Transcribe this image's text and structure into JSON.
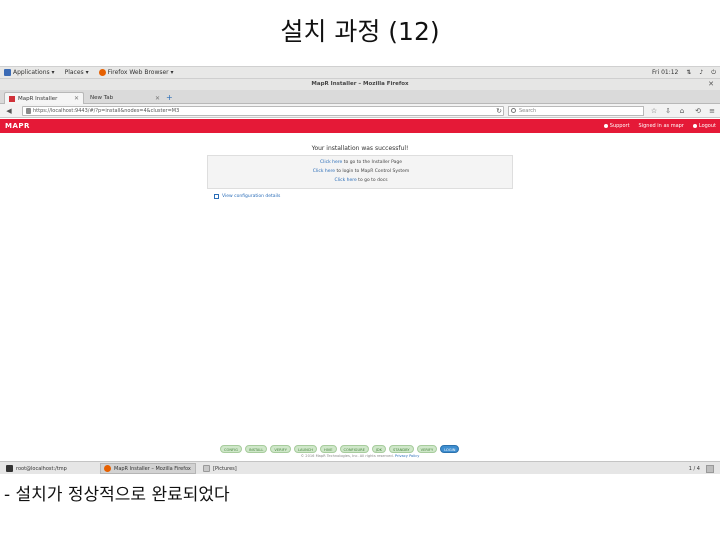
{
  "slide": {
    "title": "설치 과정 (12)",
    "caption": "-  설치가 정상적으로 완료되었다"
  },
  "gnome_bar": {
    "applications": "Applications ▾",
    "places": "Places ▾",
    "browser": "Firefox Web Browser ▾",
    "clock": "Fri 01:12",
    "icons": [
      "network-icon",
      "volume-icon",
      "power-icon"
    ]
  },
  "browser": {
    "window_title": "MapR Installer – Mozilla Firefox",
    "close_glyph": "✕",
    "tabs": [
      {
        "label": "MapR Installer",
        "active": true
      },
      {
        "label": "New Tab",
        "active": false
      }
    ],
    "url": "https://localhost:9443/#/?p=install&nodes=4&cluster=M3",
    "search_placeholder": "Search",
    "nav_glyphs": {
      "back": "◀",
      "reload": "↻",
      "new_tab": "+",
      "bookmark": "☆",
      "home": "⌂",
      "menu": "≡"
    }
  },
  "mapr": {
    "logo": "MAPR",
    "links": [
      "Support",
      "Signed in as mapr",
      "Logout"
    ]
  },
  "content": {
    "success_title": "Your installation was successful!",
    "lines": [
      {
        "link": "Click here",
        "text": " to go to the Installer Page"
      },
      {
        "link": "Click here",
        "text": " to login to MapR Control System"
      },
      {
        "link": "Click here",
        "text": " to go to docs"
      }
    ],
    "view_details": "View configuration details"
  },
  "steps": [
    {
      "label": "CONFIG",
      "current": false
    },
    {
      "label": "INSTALL",
      "current": false
    },
    {
      "label": "VERIFY",
      "current": false
    },
    {
      "label": "LAUNCH",
      "current": false
    },
    {
      "label": "HIVE",
      "current": false
    },
    {
      "label": "CONFIGURE",
      "current": false
    },
    {
      "label": "JDK",
      "current": false
    },
    {
      "label": "STANDBY",
      "current": false
    },
    {
      "label": "VERIFY",
      "current": false
    },
    {
      "label": "LOGIN",
      "current": true
    }
  ],
  "footer": {
    "text": "© 2016 MapR Technologies, Inc. All rights reserved. ",
    "link": "Privacy Policy"
  },
  "taskbar": {
    "tasks": [
      {
        "label": "root@localhost:/tmp",
        "active": false
      },
      {
        "label": "MapR Installer – Mozilla Firefox",
        "active": true
      },
      {
        "label": "[Pictures]",
        "active": false
      }
    ],
    "pager": "1 / 4"
  },
  "colors": {
    "mapr_red": "#e51937",
    "link_blue": "#2a6db8",
    "step_done": "#cfe7c9",
    "step_current": "#3e8ed0"
  }
}
